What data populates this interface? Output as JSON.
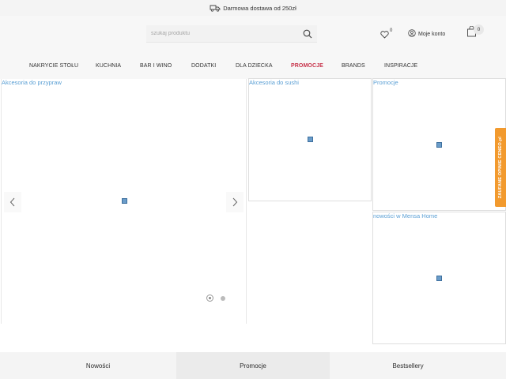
{
  "topbar": {
    "shipping_text": "Darmowa dostawa od 250zł",
    "icon": "truck-icon"
  },
  "header": {
    "search_placeholder": "szukaj produktu",
    "wishlist_count": "0",
    "account_label": "Moje konto",
    "cart_count": "0"
  },
  "nav": {
    "items": [
      {
        "label": "NAKRYCIE STOŁU"
      },
      {
        "label": "KUCHNIA"
      },
      {
        "label": "BAR I WINO"
      },
      {
        "label": "DODATKI"
      },
      {
        "label": "DLA DZIECKA"
      },
      {
        "label": "PROMOCJE"
      },
      {
        "label": "BRANDS"
      },
      {
        "label": "INSPIRACJE"
      }
    ],
    "promo_color": "#c7324a"
  },
  "tiles": {
    "slider_label": "Akcesoria do przypraw",
    "sushi_label": "Akcesoria do sushi",
    "promo_label": "Promocje",
    "news_label": "nowości w Mensa Home",
    "slide_count": 2,
    "active_slide": 1
  },
  "widget": {
    "label": "ZAUFANE OPINIE CENEO.pl",
    "color": "#f29a2e"
  },
  "bottom_tabs": [
    {
      "label": "Nowości"
    },
    {
      "label": "Promocje"
    },
    {
      "label": "Bestsellery"
    }
  ],
  "colors": {
    "link": "#5a9fd4",
    "accent": "#c7324a"
  }
}
